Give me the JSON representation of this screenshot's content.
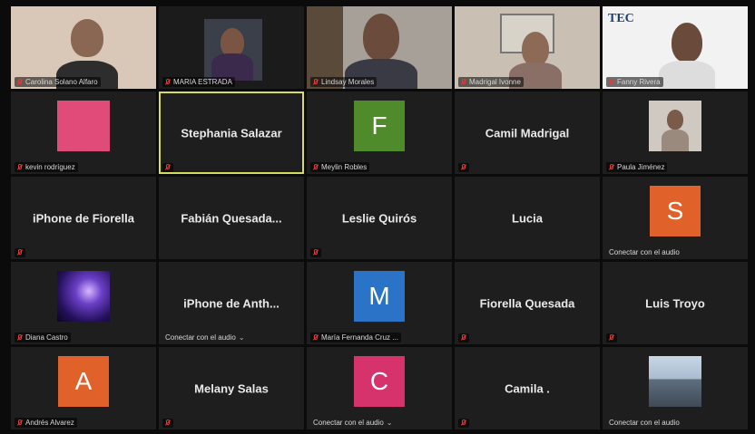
{
  "meeting": {
    "tiles": [
      {
        "name": "Carolina Solano Alfaro",
        "type": "video"
      },
      {
        "name": "MARIA ESTRADA",
        "type": "video"
      },
      {
        "name": "Lindsay Morales",
        "type": "video"
      },
      {
        "name": "Madrigal Ivonne",
        "type": "video"
      },
      {
        "name": "Fanny Rivera",
        "type": "video",
        "overlay_text": "TEC"
      },
      {
        "name": "kevin rodríguez",
        "type": "image"
      },
      {
        "name": "Stephania Salazar",
        "type": "name",
        "active_speaker": true
      },
      {
        "name": "Meylin Robles",
        "type": "avatar",
        "initial": "F",
        "color": "#4f8a2b"
      },
      {
        "name": "Camil Madrigal",
        "type": "name"
      },
      {
        "name": "Paula Jiménez",
        "type": "image"
      },
      {
        "name": "iPhone de Fiorella",
        "type": "name"
      },
      {
        "name": "Fabián  Quesada...",
        "type": "name"
      },
      {
        "name": "Leslie Quirós",
        "type": "name"
      },
      {
        "name": "Lucia",
        "type": "name"
      },
      {
        "name": "Conectar con el audio",
        "type": "avatar",
        "initial": "S",
        "color": "#e0612a"
      },
      {
        "name": "Diana Castro",
        "type": "image"
      },
      {
        "name": "iPhone de Anth...",
        "type": "name",
        "bottom": "Conectar con el audio"
      },
      {
        "name": "María Fernanda Cruz ...",
        "type": "avatar",
        "initial": "M",
        "color": "#2a73c7"
      },
      {
        "name": "Fiorella Quesada",
        "type": "name"
      },
      {
        "name": "Luis Troyo",
        "type": "name"
      },
      {
        "name": "Andrés Alvarez",
        "type": "avatar",
        "initial": "A",
        "color": "#e0612a"
      },
      {
        "name": "Melany Salas",
        "type": "name"
      },
      {
        "name": "Conectar con el audio",
        "type": "avatar",
        "initial": "C",
        "color": "#d6336c"
      },
      {
        "name": "Camila .",
        "type": "name"
      },
      {
        "name": "Conectar con el audio",
        "type": "image"
      }
    ]
  }
}
